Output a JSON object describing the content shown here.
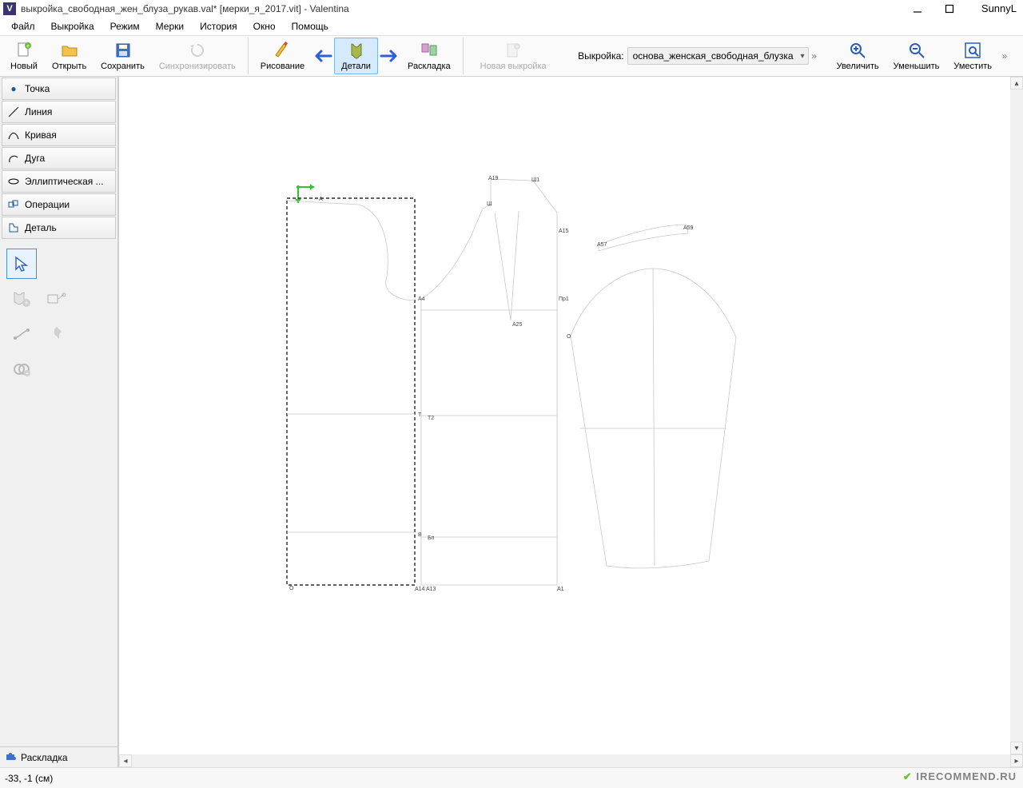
{
  "title": "выкройка_свободная_жен_блуза_рукав.val* [мерки_я_2017.vit] - Valentina",
  "user": "SunnyL",
  "menu": {
    "file": "Файл",
    "pattern": "Выкройка",
    "mode": "Режим",
    "measurements": "Мерки",
    "history": "История",
    "window": "Окно",
    "help": "Помощь"
  },
  "toolbar": {
    "new": "Новый",
    "open": "Открыть",
    "save": "Сохранить",
    "sync": "Синхронизировать",
    "drawing": "Рисование",
    "details": "Детали",
    "layout": "Раскладка",
    "new_pattern": "Новая выкройка",
    "pattern_label": "Выкройка:",
    "pattern_value": "основа_женская_свободная_блузка",
    "zoom_in": "Увеличить",
    "zoom_out": "Уменьшить",
    "zoom_fit": "Уместить"
  },
  "sidebar": {
    "tabs": {
      "point": "Точка",
      "line": "Линия",
      "curve": "Кривая",
      "arc": "Дуга",
      "elliptic": "Эллиптическая ...",
      "ops": "Операции",
      "detail": "Деталь"
    },
    "footer": "Раскладка"
  },
  "status": {
    "coords": "-33, -1 (см)"
  },
  "watermark": "IRECOMMEND.RU",
  "labels": {
    "A19": "A19",
    "Ш1": "Ш1",
    "Ш": "Ш",
    "A15": "A15",
    "A57": "A57",
    "A59": "A59",
    "Пр1": "Пр1",
    "A25": "A25",
    "Т": "Т",
    "Т2": "Т2",
    "В": "В",
    "Вп": "Бп",
    "А14": "А14",
    "A13": "A13",
    "A1": "A1",
    "О": "О",
    "A": "А",
    "A4": "А4",
    "О2": "О"
  }
}
